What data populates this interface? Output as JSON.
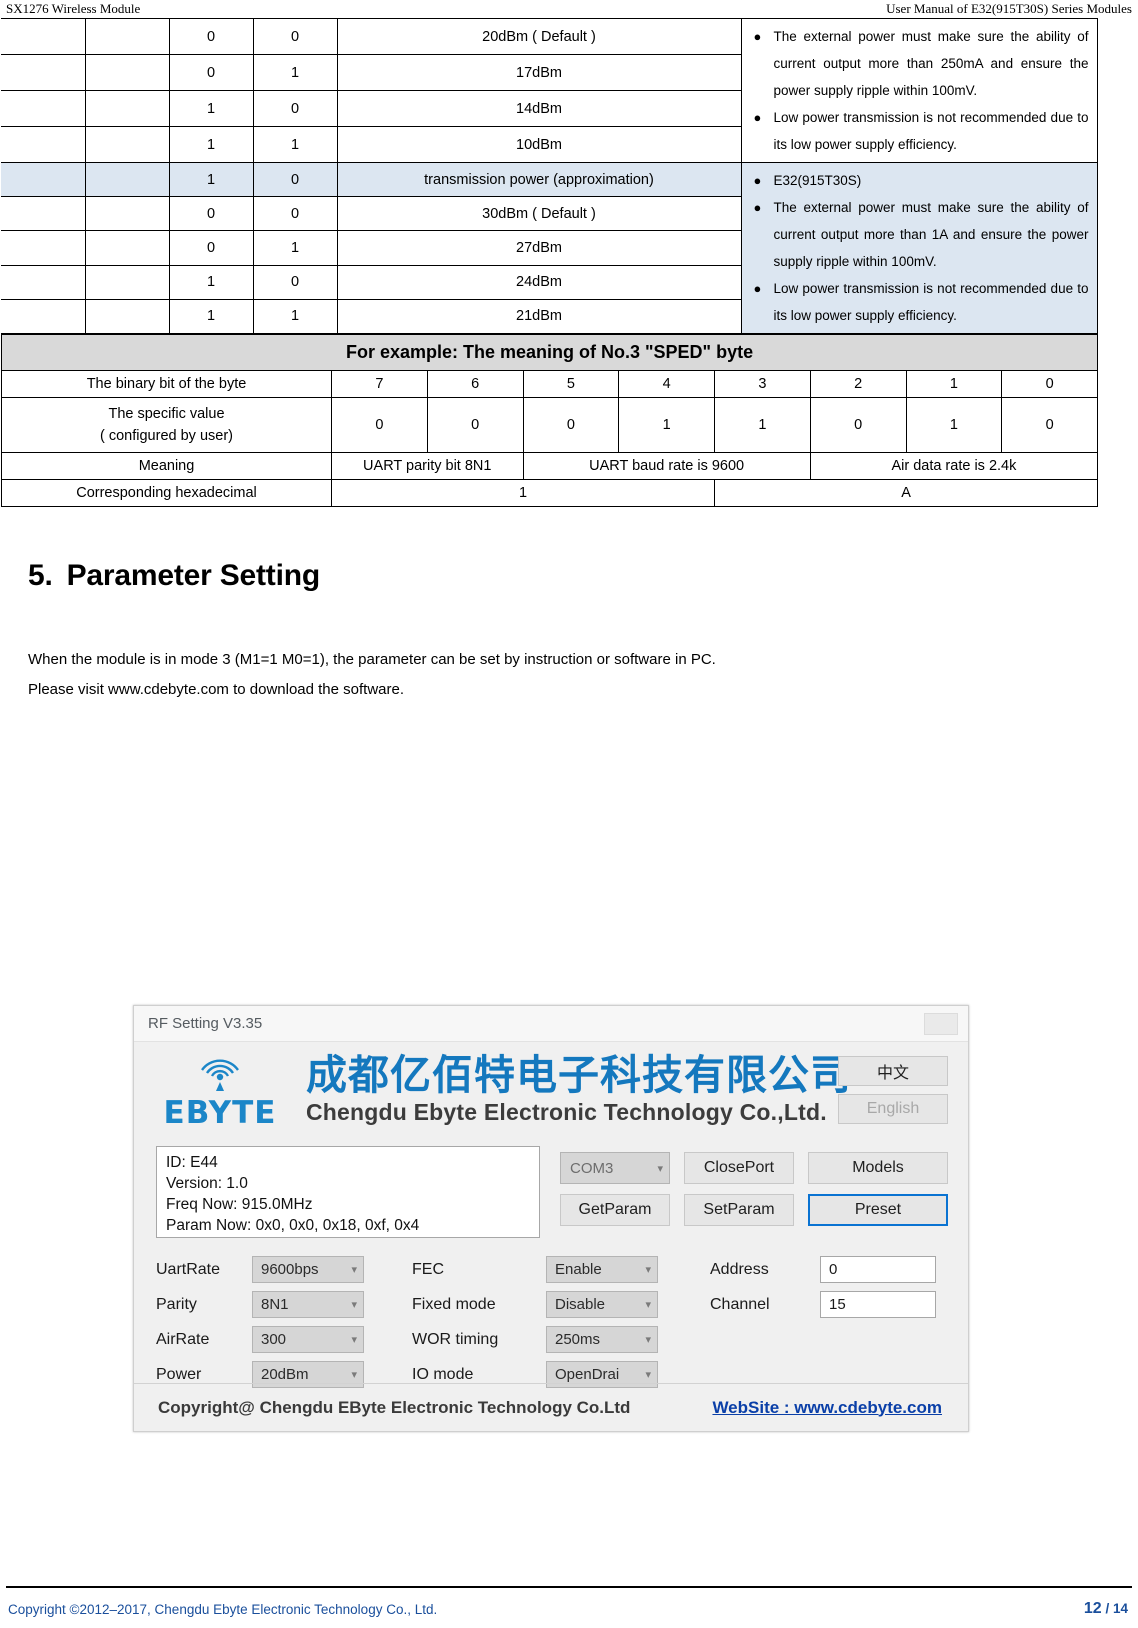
{
  "runhead": {
    "left": "SX1276 Wireless Module",
    "right": "User Manual of E32(915T30S) Series Modules"
  },
  "power_table": {
    "rows": [
      {
        "b1": "0",
        "b0": "0",
        "value": "20dBm ( Default )",
        "highlight": false
      },
      {
        "b1": "0",
        "b0": "1",
        "value": "17dBm",
        "highlight": false
      },
      {
        "b1": "1",
        "b0": "0",
        "value": "14dBm",
        "highlight": false
      },
      {
        "b1": "1",
        "b0": "1",
        "value": "10dBm",
        "highlight": false
      },
      {
        "b1": "1",
        "b0": "0",
        "value": "transmission power (approximation)",
        "highlight": true
      },
      {
        "b1": "0",
        "b0": "0",
        "value": "30dBm ( Default )",
        "highlight": false
      },
      {
        "b1": "0",
        "b0": "1",
        "value": "27dBm",
        "highlight": false
      },
      {
        "b1": "1",
        "b0": "0",
        "value": "24dBm",
        "highlight": false
      },
      {
        "b1": "1",
        "b0": "1",
        "value": "21dBm",
        "highlight": false
      }
    ],
    "notes_group_1": [
      {
        "bullet": "●",
        "text": "The external power must make sure the ability of current output more than 250mA and ensure the power supply ripple within 100mV."
      },
      {
        "bullet": "●",
        "text": "Low power transmission is not recommended due to its low power supply efficiency."
      }
    ],
    "notes_group_2": [
      {
        "bullet": "●",
        "text": "E32(915T30S)"
      },
      {
        "bullet": "●",
        "text": "The external power must make sure the ability of current output more than 1A and ensure the power supply ripple within 100mV."
      },
      {
        "bullet": "●",
        "text": "Low power transmission is not recommended due to its low power supply efficiency."
      }
    ]
  },
  "example_table": {
    "title": "For example: The meaning of No.3 \"SPED\" byte",
    "row_bit_label": "The binary bit of the byte",
    "bits": [
      "7",
      "6",
      "5",
      "4",
      "3",
      "2",
      "1",
      "0"
    ],
    "row_value_label_line1": "The specific value",
    "row_value_label_line2": "( configured by user)",
    "values": [
      "0",
      "0",
      "0",
      "1",
      "1",
      "0",
      "1",
      "0"
    ],
    "row_meaning_label": "Meaning",
    "meanings": [
      {
        "text": "UART parity bit 8N1",
        "span": 2
      },
      {
        "text": "UART baud rate is 9600",
        "span": 3
      },
      {
        "text": "Air data rate is 2.4k",
        "span": 3
      }
    ],
    "row_hex_label": "Corresponding hexadecimal",
    "hex": [
      {
        "text": "1",
        "span": 4
      },
      {
        "text": "A",
        "span": 4
      }
    ]
  },
  "section": {
    "number": "5.",
    "title": "Parameter Setting",
    "paragraph_1": "When the module is in mode 3 (M1=1 M0=1), the parameter can be set by instruction or software in PC.",
    "paragraph_2": "Please visit www.cdebyte.com to download the software."
  },
  "software": {
    "window_title": "RF Setting V3.35",
    "logo_word": "EBYTE",
    "company_cn": "成都亿佰特电子科技有限公司",
    "company_en": "Chengdu Ebyte Electronic Technology Co.,Ltd.",
    "lang_cn": "中文",
    "lang_en": "English",
    "info": {
      "id": "ID: E44",
      "version": "Version: 1.0",
      "freq": "Freq Now: 915.0MHz",
      "param": "Param Now: 0x0, 0x0, 0x18, 0xf, 0x4"
    },
    "port_value": "COM3",
    "buttons": {
      "close_port": "ClosePort",
      "models": "Models",
      "get_param": "GetParam",
      "set_param": "SetParam",
      "preset": "Preset"
    },
    "params": [
      {
        "label": "UartRate",
        "value": "9600bps",
        "kind": "combo"
      },
      {
        "label": "Parity",
        "value": "8N1",
        "kind": "combo"
      },
      {
        "label": "AirRate",
        "value": "300",
        "kind": "combo"
      },
      {
        "label": "Power",
        "value": "20dBm",
        "kind": "combo"
      },
      {
        "label": "FEC",
        "value": "Enable",
        "kind": "combo"
      },
      {
        "label": "Fixed mode",
        "value": "Disable",
        "kind": "combo"
      },
      {
        "label": "WOR timing",
        "value": "250ms",
        "kind": "combo"
      },
      {
        "label": "IO mode",
        "value": "OpenDrai",
        "kind": "combo"
      },
      {
        "label": "Address",
        "value": "0",
        "kind": "text"
      },
      {
        "label": "Channel",
        "value": "15",
        "kind": "text"
      }
    ],
    "footer_left": "Copyright@ Chengdu EByte Electronic Technology Co.Ltd",
    "footer_right": "WebSite : www.cdebyte.com"
  },
  "page_footer": {
    "copyright": "Copyright ©2012–2017, Chengdu Ebyte Electronic Technology Co., Ltd.",
    "page_current": "12",
    "page_sep": " / ",
    "page_total": "14"
  }
}
